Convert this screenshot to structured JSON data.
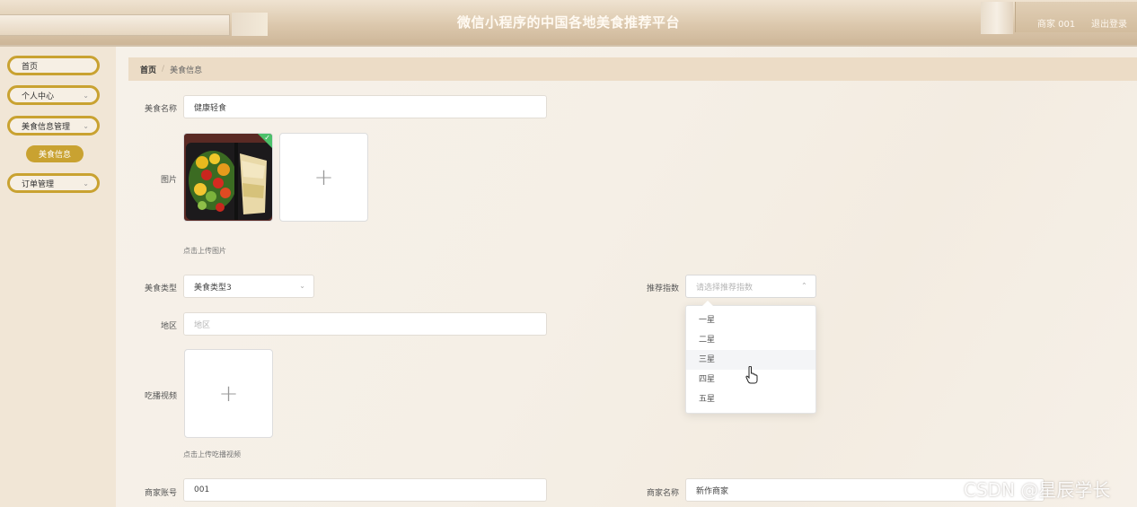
{
  "header": {
    "title": "微信小程序的中国各地美食推荐平台",
    "user": "商家 001",
    "logout": "退出登录"
  },
  "sidebar": {
    "items": [
      {
        "label": "首页"
      },
      {
        "label": "个人中心"
      },
      {
        "label": "美食信息管理"
      },
      {
        "label": "订单管理"
      }
    ],
    "sub_item": "美食信息"
  },
  "breadcrumb": {
    "home": "首页",
    "sep": "/",
    "current": "美食信息"
  },
  "form": {
    "food_name": {
      "label": "美食名称",
      "value": "健康轻食"
    },
    "image": {
      "label": "图片",
      "hint": "点击上传图片"
    },
    "food_type": {
      "label": "美食类型",
      "value": "美食类型3"
    },
    "recommend": {
      "label": "推荐指数",
      "placeholder": "请选择推荐指数",
      "options": [
        "一星",
        "二星",
        "三星",
        "四星",
        "五星"
      ],
      "hovered_index": 2
    },
    "region": {
      "label": "地区",
      "placeholder": "地区"
    },
    "video": {
      "label": "吃播视频",
      "hint": "点击上传吃播视频"
    },
    "merchant_account": {
      "label": "商家账号",
      "value": "001"
    },
    "merchant_name": {
      "label": "商家名称",
      "value": "新作商家"
    }
  },
  "icons": {
    "plus": "+",
    "chevron": "⌄",
    "check": "✓"
  },
  "colors": {
    "accent": "#c9a231",
    "breadcrumb_bg": "#ecdcc6"
  },
  "watermark": "CSDN @星辰学长"
}
